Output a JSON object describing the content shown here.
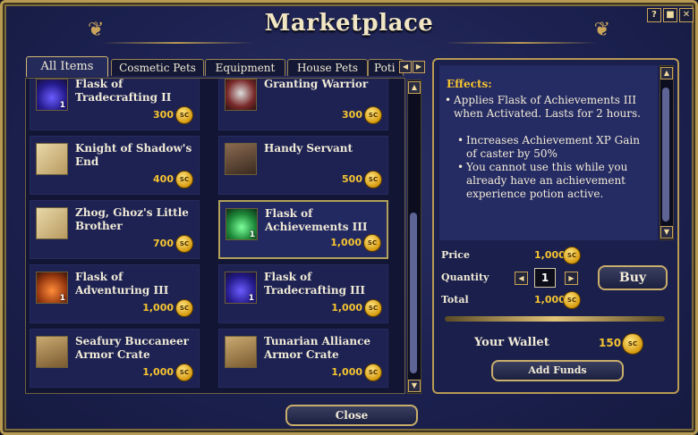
{
  "window": {
    "title": "Marketplace",
    "buttons": [
      "?",
      "■",
      "✕"
    ]
  },
  "tabs": [
    {
      "label": "All Items",
      "active": true
    },
    {
      "label": "Cosmetic Pets",
      "active": false
    },
    {
      "label": "Equipment",
      "active": false
    },
    {
      "label": "House Pets",
      "active": false
    },
    {
      "label": "Poti",
      "active": false
    }
  ],
  "items": [
    {
      "name": "Flask of Tradecrafting II",
      "price": "300",
      "qty": "1",
      "icon": "purple-flask-icon"
    },
    {
      "name": "Granting Warrior",
      "price": "300",
      "qty": "",
      "icon": "warrior-mask-icon"
    },
    {
      "name": "Knight of Shadow's End",
      "price": "400",
      "qty": "",
      "icon": "parchment-icon"
    },
    {
      "name": "Handy Servant",
      "price": "500",
      "qty": "",
      "icon": "servant-hand-icon"
    },
    {
      "name": "Zhog, Ghoz's Little Brother",
      "price": "700",
      "qty": "",
      "icon": "parchment-icon"
    },
    {
      "name": "Flask of Achievements III",
      "price": "1,000",
      "qty": "1",
      "icon": "green-flask-icon",
      "selected": true
    },
    {
      "name": "Flask of Adventuring III",
      "price": "1,000",
      "qty": "1",
      "icon": "orange-flask-icon"
    },
    {
      "name": "Flask of Tradecrafting III",
      "price": "1,000",
      "qty": "1",
      "icon": "purple-flask-icon"
    },
    {
      "name": "Seafury Buccaneer Armor Crate",
      "price": "1,000",
      "qty": "",
      "icon": "crate-icon"
    },
    {
      "name": "Tunarian Alliance Armor Crate",
      "price": "1,000",
      "qty": "",
      "icon": "crate-icon"
    }
  ],
  "coin_label": "SC",
  "details": {
    "effects_title": "Effects:",
    "effects": [
      {
        "text": "Applies Flask of Achievements III when Activated.  Lasts for 2 hours.",
        "indent": 0
      },
      {
        "text": "Increases Achievement XP Gain of caster by 50%",
        "indent": 1
      },
      {
        "text": "You cannot use this while you already have an achievement experience potion active.",
        "indent": 1
      }
    ],
    "price_label": "Price",
    "price_value": "1,000",
    "quantity_label": "Quantity",
    "quantity_value": "1",
    "total_label": "Total",
    "total_value": "1,000",
    "buy_label": "Buy",
    "wallet_label": "Your Wallet",
    "wallet_value": "150",
    "add_funds_label": "Add Funds"
  },
  "close_label": "Close",
  "colors": {
    "accent_gold": "#c9a45a",
    "price_gold": "#f6c430",
    "panel_blue": "#1d2253"
  }
}
